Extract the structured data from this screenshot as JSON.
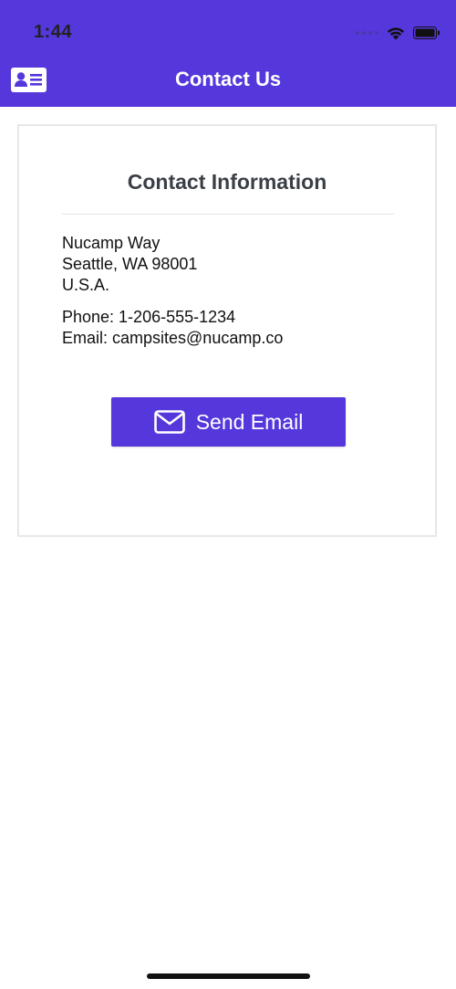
{
  "status_bar": {
    "time": "1:44"
  },
  "nav": {
    "title": "Contact Us",
    "menu_icon": "contact-card-icon"
  },
  "card": {
    "title": "Contact Information",
    "address_lines": [
      "Nucamp Way",
      "Seattle, WA 98001",
      "U.S.A."
    ],
    "phone": "Phone: 1-206-555-1234",
    "email": "Email: campsites@nucamp.co"
  },
  "button": {
    "label": "Send Email",
    "icon": "envelope-icon"
  },
  "colors": {
    "accent": "#5637DB",
    "background": "#ffffff",
    "card_border": "#e6e7ea"
  }
}
